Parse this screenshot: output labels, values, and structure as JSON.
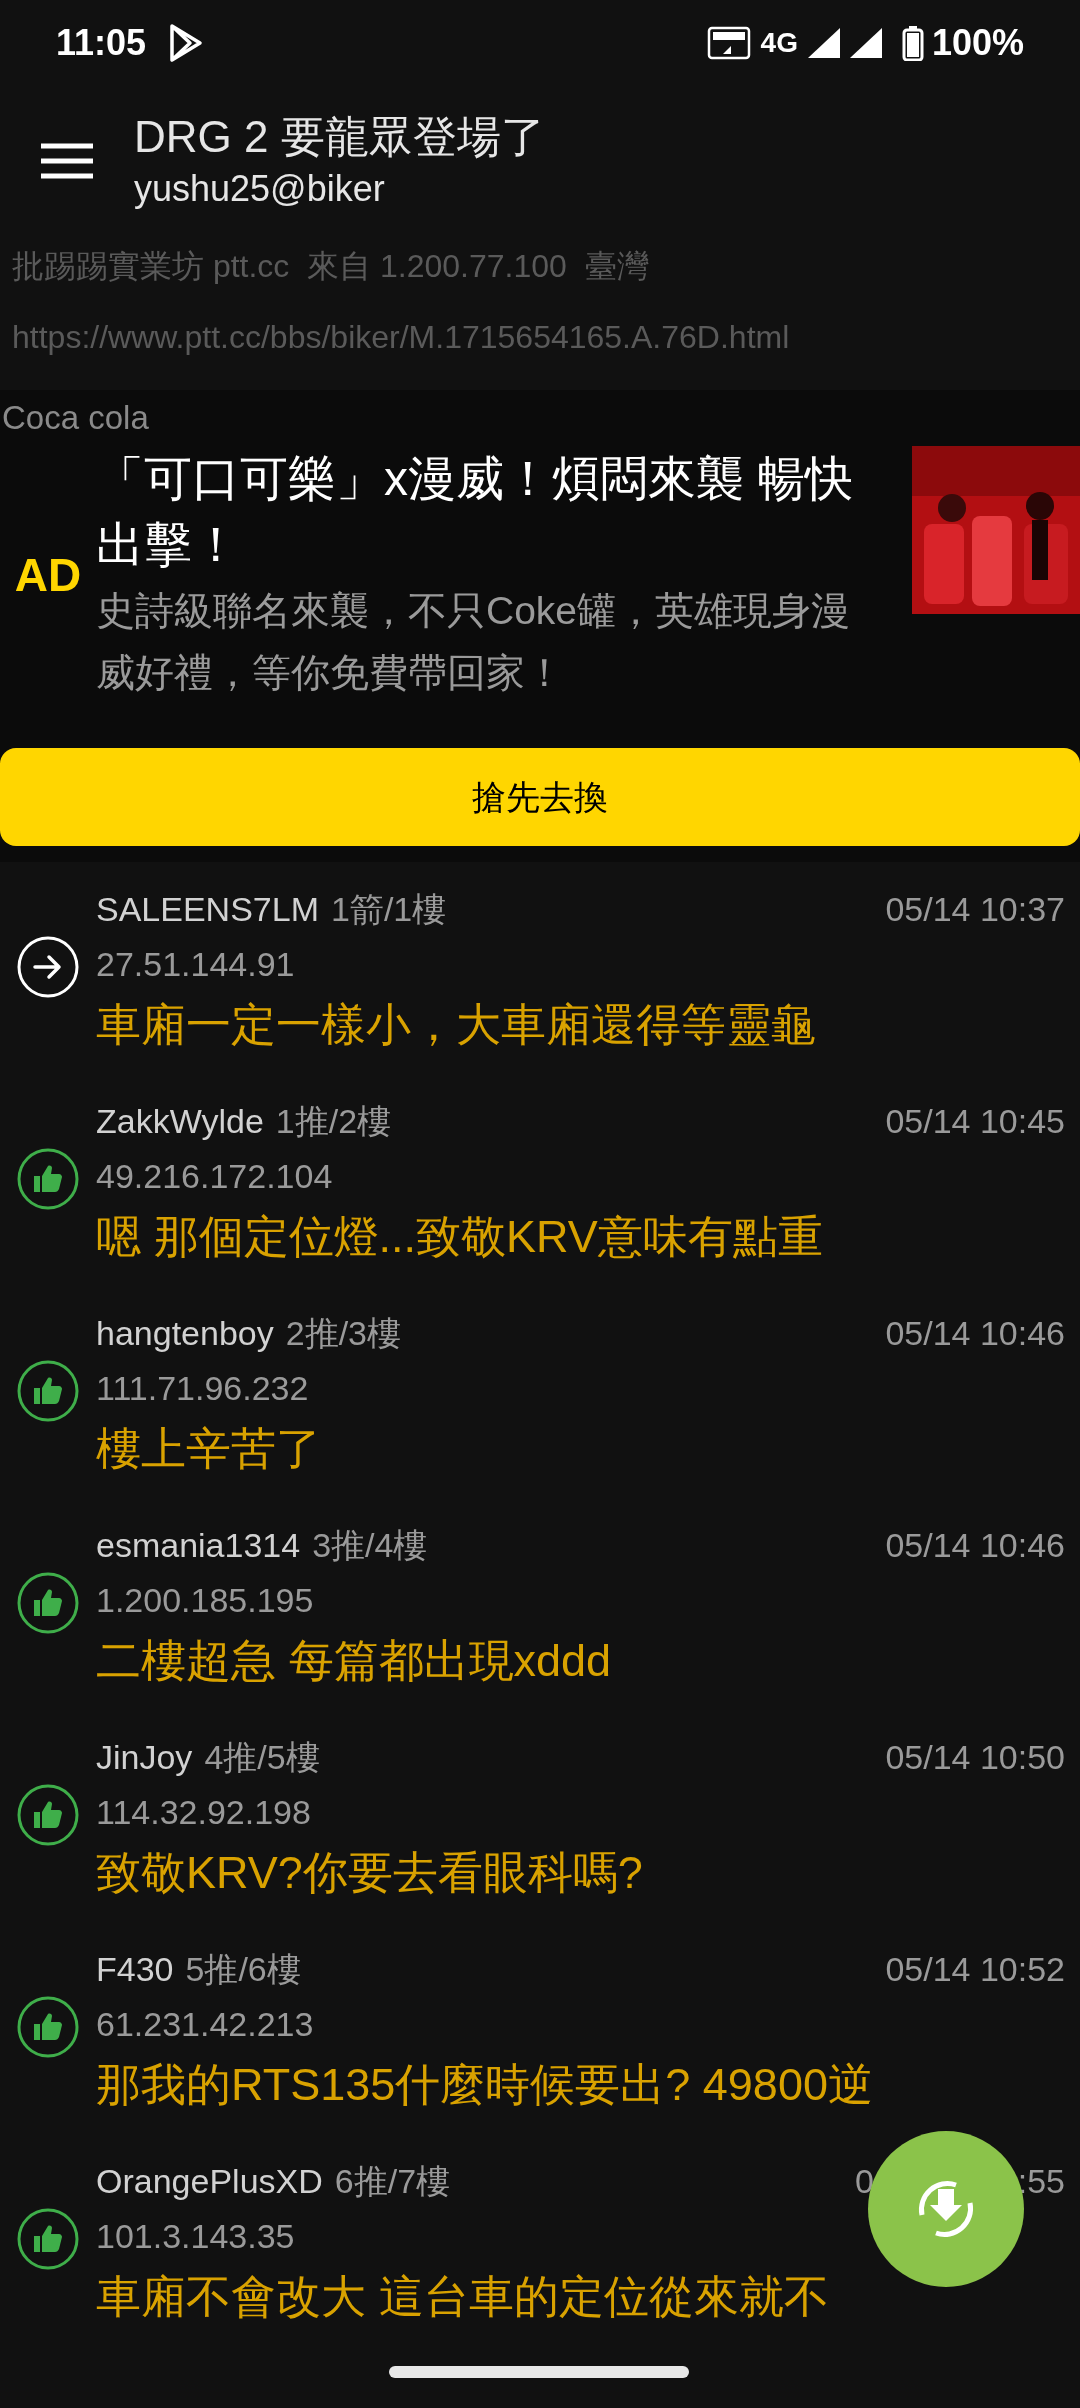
{
  "status_bar": {
    "time": "11:05",
    "network": "4G",
    "battery": "100%"
  },
  "header": {
    "title": "DRG 2 要龍眾登場了",
    "subtitle": "yushu25@biker"
  },
  "article_meta": {
    "source": "批踢踢實業坊 ptt.cc  來自 1.200.77.100  臺灣",
    "url": "https://www.ptt.cc/bbs/biker/M.1715654165.A.76D.html"
  },
  "ad": {
    "advertiser": "Coca cola",
    "label": "AD",
    "title": "「可口可樂」x漫威！煩悶來襲 暢快出擊！",
    "description": "史詩級聯名來襲，不只Coke罐，英雄現身漫威好禮，等你免費帶回家！",
    "button": "搶先去換"
  },
  "comments": [
    {
      "kind": "arrow",
      "user": "SALEENS7LM",
      "floor": "1箭/1樓",
      "time": "05/14 10:37",
      "ip": "27.51.144.91",
      "text": "車廂一定一樣小，大車廂還得等靈龜"
    },
    {
      "kind": "push",
      "user": "ZakkWylde",
      "floor": "1推/2樓",
      "time": "05/14 10:45",
      "ip": "49.216.172.104",
      "text": "嗯 那個定位燈...致敬KRV意味有點重"
    },
    {
      "kind": "push",
      "user": "hangtenboy",
      "floor": "2推/3樓",
      "time": "05/14 10:46",
      "ip": "111.71.96.232",
      "text": "樓上辛苦了"
    },
    {
      "kind": "push",
      "user": "esmania1314",
      "floor": "3推/4樓",
      "time": "05/14 10:46",
      "ip": "1.200.185.195",
      "text": "二樓超急 每篇都出現xddd"
    },
    {
      "kind": "push",
      "user": "JinJoy",
      "floor": "4推/5樓",
      "time": "05/14 10:50",
      "ip": "114.32.92.198",
      "text": "致敬KRV?你要去看眼科嗎?"
    },
    {
      "kind": "push",
      "user": "F430",
      "floor": "5推/6樓",
      "time": "05/14 10:52",
      "ip": "61.231.42.213",
      "text": "那我的RTS135什麼時候要出? 49800逆"
    },
    {
      "kind": "push",
      "user": "OrangePlusXD",
      "floor": "6推/7樓",
      "time_parts": [
        "0",
        ":55"
      ],
      "ip": "101.3.143.35",
      "text": "車廂不會改大 這台車的定位從來就不"
    }
  ]
}
